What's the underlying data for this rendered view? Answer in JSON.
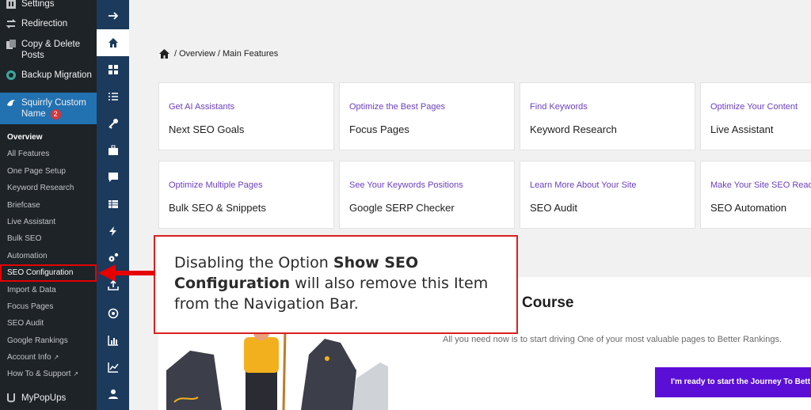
{
  "wp_menu": {
    "settings": "Settings",
    "redirection": "Redirection",
    "copy_delete_1": "Copy & Delete",
    "copy_delete_2": "Posts",
    "backup_migration": "Backup Migration",
    "squirrly_1": "Squirrly Custom",
    "squirrly_2": "Name",
    "squirrly_badge": "2",
    "mypopups": "MyPopUps"
  },
  "submenu": [
    "Overview",
    "All Features",
    "One Page Setup",
    "Keyword Research",
    "Briefcase",
    "Live Assistant",
    "Bulk SEO",
    "Automation",
    "SEO Configuration",
    "Import & Data",
    "Focus Pages",
    "SEO Audit",
    "Google Rankings",
    "Account Info",
    "How To & Support"
  ],
  "rail_icons": [
    "arrow-right-icon",
    "home-icon",
    "dashboard-icon",
    "checklist-icon",
    "key-icon",
    "briefcase-icon",
    "chat-icon",
    "table-icon",
    "bolt-icon",
    "gears-icon",
    "upload-icon",
    "target-icon",
    "bar-chart-icon",
    "line-chart-icon",
    "user-icon"
  ],
  "breadcrumb": {
    "sep1": "/",
    "item1": "Overview",
    "sep2": "/",
    "item2": "Main Features"
  },
  "cards": [
    {
      "sub": "Get AI Assistants",
      "title": "Next SEO Goals"
    },
    {
      "sub": "Optimize the Best Pages",
      "title": "Focus Pages"
    },
    {
      "sub": "Find Keywords",
      "title": "Keyword Research"
    },
    {
      "sub": "Optimize Your Content",
      "title": "Live Assistant"
    },
    {
      "sub": "Optimize Multiple Pages",
      "title": "Bulk SEO & Snippets"
    },
    {
      "sub": "See Your Keywords Positions",
      "title": "Google SERP Checker"
    },
    {
      "sub": "Learn More About Your Site",
      "title": "SEO Audit"
    },
    {
      "sub": "Make Your Site SEO Ready",
      "title": "SEO Automation"
    }
  ],
  "journey": {
    "title": "ney Course",
    "text": "All you need now is to start driving One of your most valuable pages to Better Rankings.",
    "button": "I'm ready to start the Journey To Bett"
  },
  "callout": {
    "part1": "Disabling the Option ",
    "bold": "Show SEO Configuration",
    "part2": " will also remove this Item from the Navigation Bar."
  },
  "colors": {
    "sidebar": "#1d2327",
    "rail": "#1b3a5c",
    "accent_purple": "#6b3fbf",
    "button": "#5b0fd6",
    "highlight_red": "#e60000"
  }
}
